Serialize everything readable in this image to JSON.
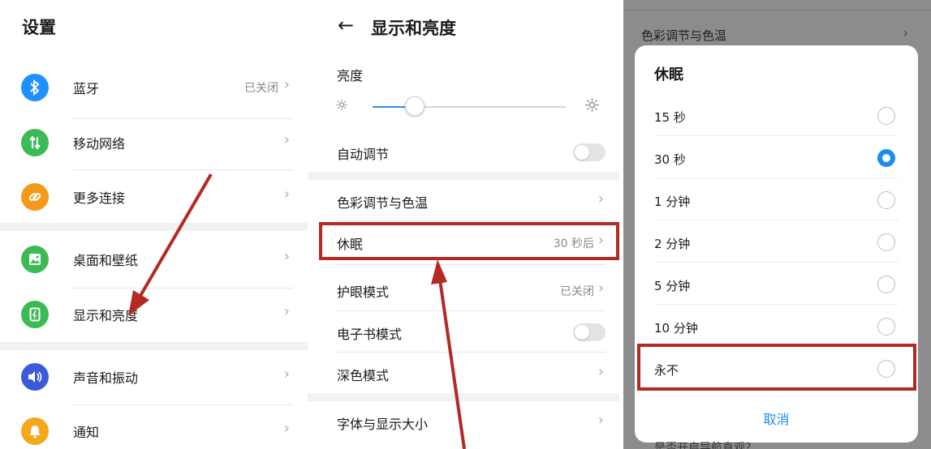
{
  "panel1": {
    "title": "设置",
    "items": [
      {
        "label": "蓝牙",
        "value": "已关闭",
        "icon": "bluetooth-icon",
        "color": "#1e90ff"
      },
      {
        "label": "移动网络",
        "value": "",
        "icon": "mobile-data-icon",
        "color": "#3cba54"
      },
      {
        "label": "更多连接",
        "value": "",
        "icon": "link-icon",
        "color": "#f39a1b"
      },
      {
        "label": "桌面和壁纸",
        "value": "",
        "icon": "wallpaper-icon",
        "color": "#3cba54"
      },
      {
        "label": "显示和亮度",
        "value": "",
        "icon": "display-icon",
        "color": "#3cba54"
      },
      {
        "label": "声音和振动",
        "value": "",
        "icon": "sound-icon",
        "color": "#3b5bd9"
      },
      {
        "label": "通知",
        "value": "",
        "icon": "bell-icon",
        "color": "#f3a91b"
      }
    ]
  },
  "panel2": {
    "title": "显示和亮度",
    "brightness_label": "亮度",
    "brightness_level": 0.22,
    "rows": [
      {
        "label": "自动调节",
        "type": "toggle",
        "on": false
      },
      {
        "label": "色彩调节与色温",
        "type": "link",
        "value": ""
      },
      {
        "label": "休眠",
        "type": "link",
        "value": "30 秒后"
      },
      {
        "label": "护眼模式",
        "type": "link",
        "value": "已关闭"
      },
      {
        "label": "电子书模式",
        "type": "toggle",
        "on": false
      },
      {
        "label": "深色模式",
        "type": "link",
        "value": ""
      },
      {
        "label": "字体与显示大小",
        "type": "link",
        "value": ""
      }
    ]
  },
  "panel3": {
    "background_row_label": "色彩调节与色温",
    "dialog_title": "休眠",
    "options": [
      {
        "label": "15 秒",
        "selected": false
      },
      {
        "label": "30 秒",
        "selected": true
      },
      {
        "label": "1 分钟",
        "selected": false
      },
      {
        "label": "2 分钟",
        "selected": false
      },
      {
        "label": "5 分钟",
        "selected": false
      },
      {
        "label": "10 分钟",
        "selected": false
      },
      {
        "label": "永不",
        "selected": false
      }
    ],
    "cancel_label": "取消",
    "bottom_peek": "是否开启导航直观？"
  },
  "colors": {
    "accent": "#1a8cf0",
    "highlight_red": "#b32a23"
  }
}
